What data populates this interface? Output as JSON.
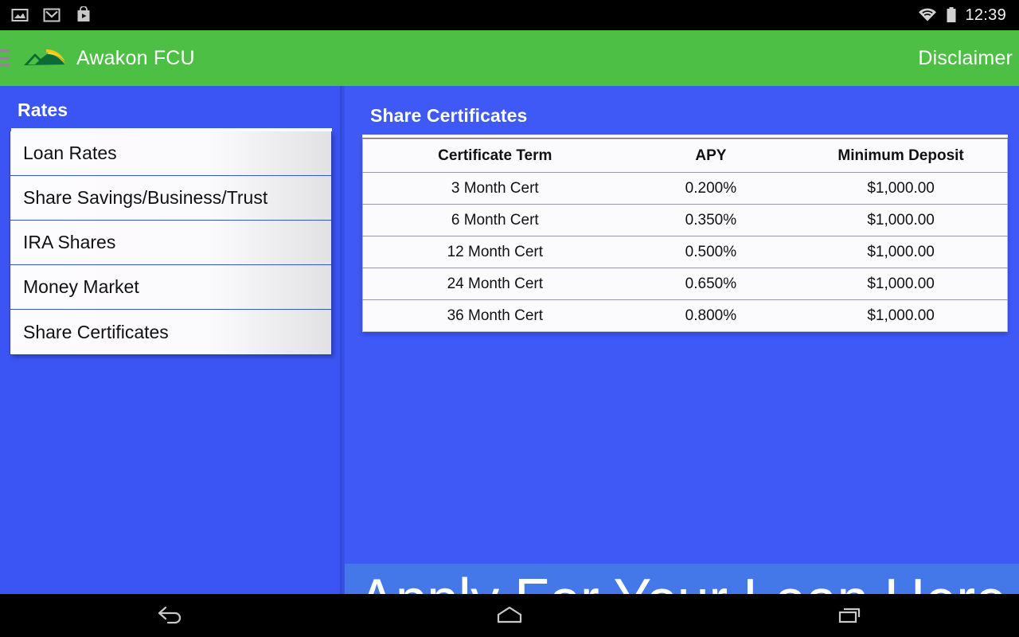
{
  "statusbar": {
    "clock": "12:39",
    "icons": [
      "gallery-icon",
      "gmail-icon",
      "play-store-icon"
    ],
    "right_icons": [
      "wifi-icon",
      "battery-icon"
    ]
  },
  "appbar": {
    "menu_icon": "hamburger-menu-icon",
    "logo_icon": "awakon-fcu-logo-icon",
    "title": "Awakon FCU",
    "disclaimer_label": "Disclaimer",
    "background_color": "#4CBF44",
    "text_color": "#FFFFFF"
  },
  "sidebar": {
    "heading": "Rates",
    "items": [
      {
        "label": "Loan Rates"
      },
      {
        "label": "Share Savings/Business/Trust"
      },
      {
        "label": "IRA Shares"
      },
      {
        "label": "Money Market"
      },
      {
        "label": "Share Certificates"
      }
    ],
    "background_color": "#3B55F5"
  },
  "main": {
    "heading": "Share Certificates",
    "background_color": "#3F59F7",
    "table": {
      "columns": [
        "Certificate Term",
        "APY",
        "Minimum Deposit"
      ],
      "rows": [
        [
          "3 Month Cert",
          "0.200%",
          "$1,000.00"
        ],
        [
          "6 Month Cert",
          "0.350%",
          "$1,000.00"
        ],
        [
          "12 Month Cert",
          "0.500%",
          "$1,000.00"
        ],
        [
          "24 Month Cert",
          "0.650%",
          "$1,000.00"
        ],
        [
          "36 Month Cert",
          "0.800%",
          "$1,000.00"
        ]
      ]
    }
  },
  "ad_banner": {
    "text": "Apply For Your Loan Here",
    "background_color": "#4477E8",
    "text_color": "#FFFFFF"
  },
  "navbar": {
    "buttons": [
      "back-icon",
      "home-icon",
      "recents-icon"
    ],
    "background_color": "#000000"
  }
}
